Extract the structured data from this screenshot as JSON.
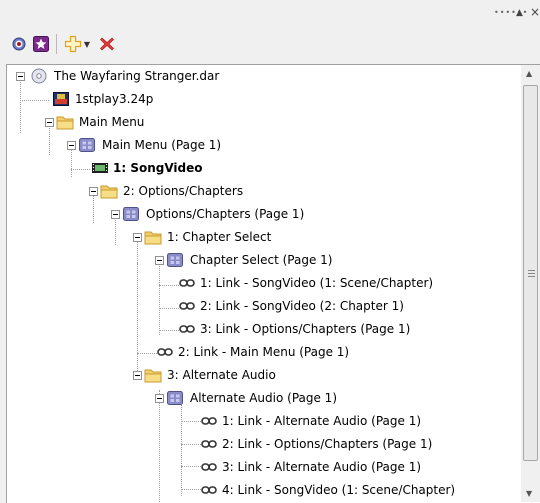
{
  "window": {
    "grip": "••••••",
    "controls": {
      "pin": "▲",
      "close": "×"
    }
  },
  "toolbar": {
    "icons": [
      "target-icon",
      "star-icon",
      "add-icon",
      "delete-icon"
    ]
  },
  "tree": {
    "nodes": [
      {
        "label": "The Wayfaring Stranger.dar",
        "icon": "disc-icon",
        "bold": false
      },
      {
        "label": "1stplay3.24p",
        "icon": "image-icon",
        "bold": false
      },
      {
        "label": "Main Menu",
        "icon": "folder-icon",
        "bold": false
      },
      {
        "label": "Main Menu (Page 1)",
        "icon": "page-icon",
        "bold": false
      },
      {
        "label": "1: SongVideo",
        "icon": "film-icon",
        "bold": true
      },
      {
        "label": "2: Options/Chapters",
        "icon": "folder-icon",
        "bold": false
      },
      {
        "label": "Options/Chapters (Page 1)",
        "icon": "page-icon",
        "bold": false
      },
      {
        "label": "1: Chapter Select",
        "icon": "folder-icon",
        "bold": false
      },
      {
        "label": "Chapter Select (Page 1)",
        "icon": "page-icon",
        "bold": false
      },
      {
        "label": "1: Link - SongVideo (1: Scene/Chapter)",
        "icon": "link-icon",
        "bold": false
      },
      {
        "label": "2: Link - SongVideo (2: Chapter 1)",
        "icon": "link-icon",
        "bold": false
      },
      {
        "label": "3: Link - Options/Chapters (Page 1)",
        "icon": "link-icon",
        "bold": false
      },
      {
        "label": "2: Link - Main Menu (Page 1)",
        "icon": "link-icon",
        "bold": false
      },
      {
        "label": "3: Alternate Audio",
        "icon": "folder-icon",
        "bold": false
      },
      {
        "label": "Alternate Audio (Page 1)",
        "icon": "page-icon",
        "bold": false
      },
      {
        "label": "1: Link - Alternate Audio (Page 1)",
        "icon": "link-icon",
        "bold": false
      },
      {
        "label": "2: Link - Options/Chapters (Page 1)",
        "icon": "link-icon",
        "bold": false
      },
      {
        "label": "3: Link - Alternate Audio (Page 1)",
        "icon": "link-icon",
        "bold": false
      },
      {
        "label": "4: Link - SongVideo (1: Scene/Chapter)",
        "icon": "link-icon",
        "bold": false
      }
    ]
  },
  "colors": {
    "folder": "#f0c860",
    "page": "#8a8cc8",
    "delete": "#e03030",
    "add": "#f0b030",
    "star": "#7a2a8a"
  }
}
